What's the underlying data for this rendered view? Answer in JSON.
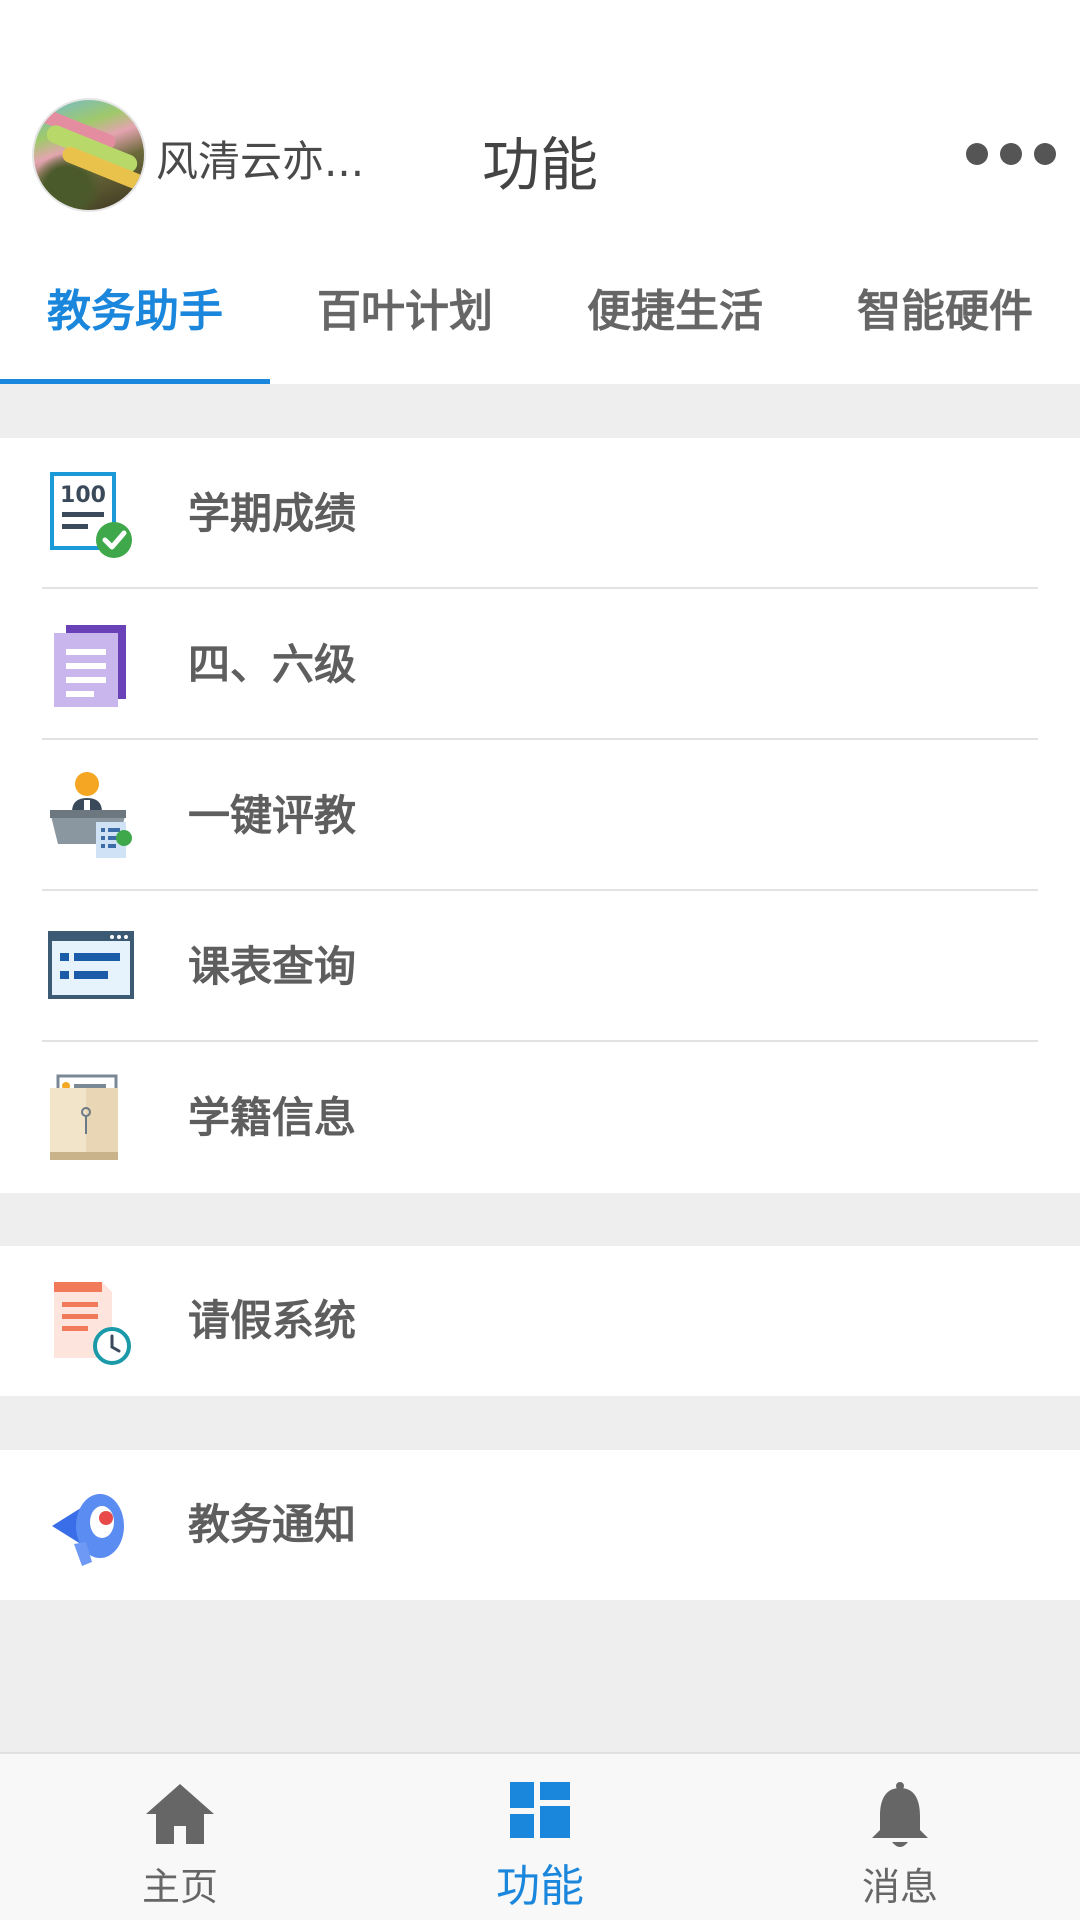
{
  "header": {
    "username": "风清云亦...",
    "title": "功能"
  },
  "tabs": [
    {
      "label": "教务助手",
      "active": true
    },
    {
      "label": "百叶计划",
      "active": false
    },
    {
      "label": "便捷生活",
      "active": false
    },
    {
      "label": "智能硬件",
      "active": false
    }
  ],
  "groups": [
    {
      "items": [
        {
          "label": "学期成绩",
          "icon": "score-report-icon"
        },
        {
          "label": "四、六级",
          "icon": "cet-document-icon"
        },
        {
          "label": "一键评教",
          "icon": "teacher-evaluation-icon"
        },
        {
          "label": "课表查询",
          "icon": "schedule-window-icon"
        },
        {
          "label": "学籍信息",
          "icon": "student-file-folder-icon"
        }
      ]
    },
    {
      "items": [
        {
          "label": "请假系统",
          "icon": "leave-clock-document-icon"
        }
      ]
    },
    {
      "items": [
        {
          "label": "教务通知",
          "icon": "megaphone-icon"
        }
      ]
    }
  ],
  "bottom_nav": [
    {
      "label": "主页",
      "icon": "home-icon",
      "active": false
    },
    {
      "label": "功能",
      "icon": "grid-dashboard-icon",
      "active": true
    },
    {
      "label": "消息",
      "icon": "bell-icon",
      "active": false
    }
  ],
  "colors": {
    "accent": "#1a86dc",
    "background_gray": "#eeeeee",
    "text": "#5e5e5e"
  }
}
